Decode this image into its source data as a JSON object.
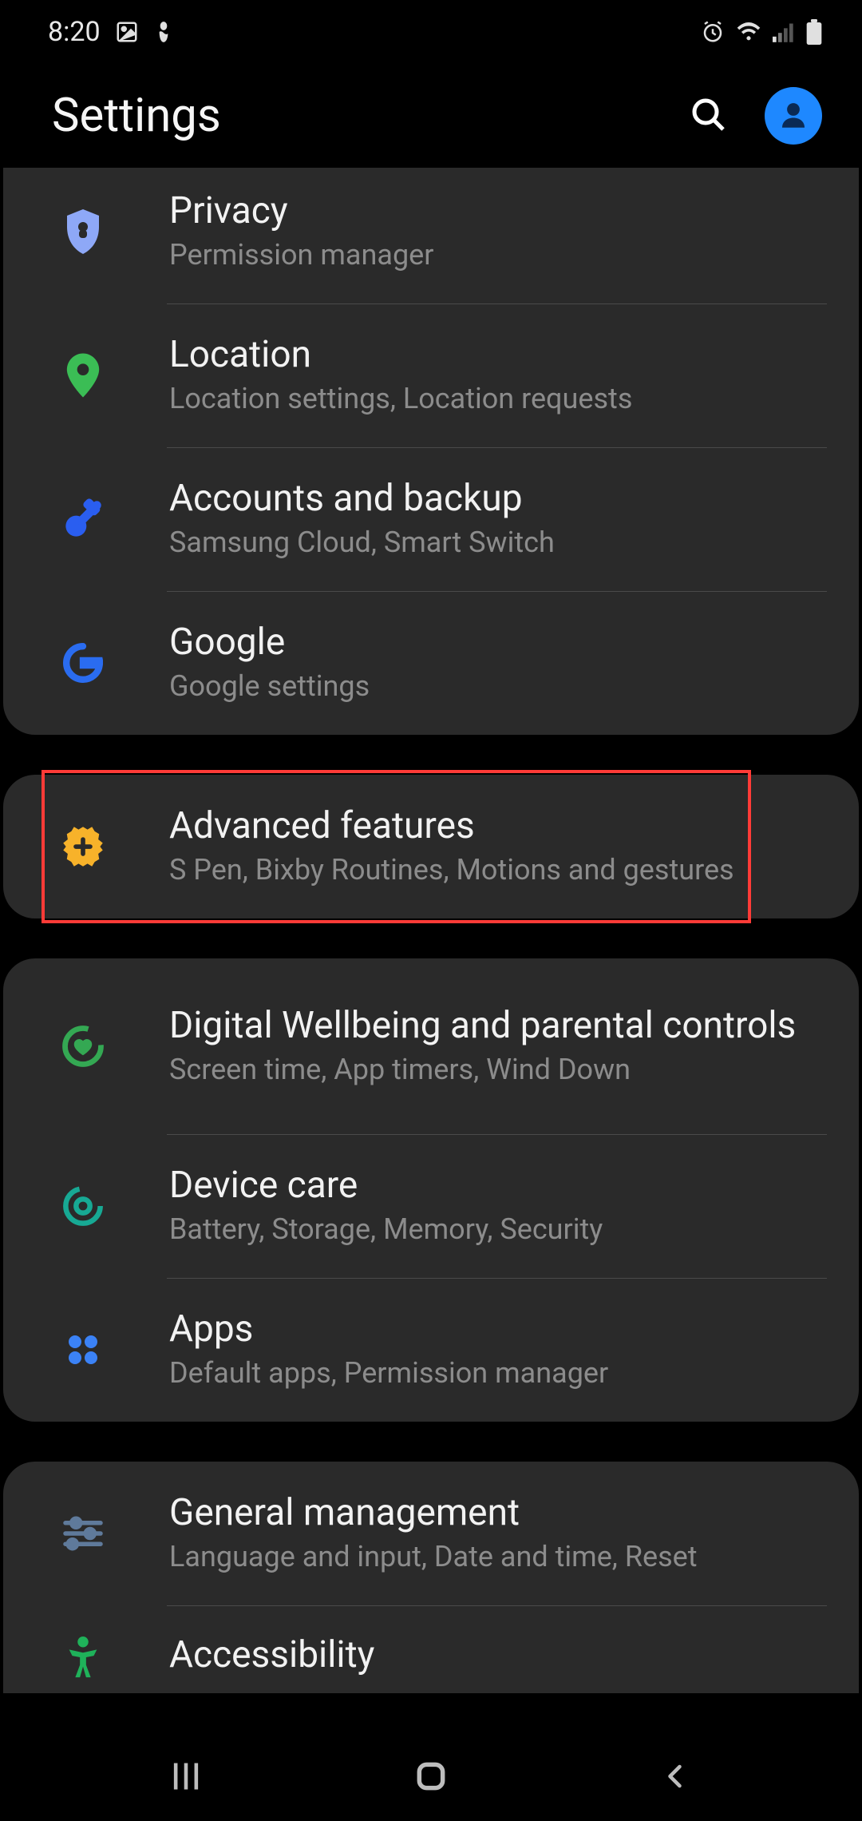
{
  "status": {
    "time": "8:20"
  },
  "header": {
    "title": "Settings"
  },
  "groups": [
    {
      "cutTop": true,
      "rows": [
        {
          "icon": "privacy",
          "title": "Privacy",
          "sub": "Permission manager"
        },
        {
          "icon": "location",
          "title": "Location",
          "sub": "Location settings, Location requests"
        },
        {
          "icon": "accounts",
          "title": "Accounts and backup",
          "sub": "Samsung Cloud, Smart Switch"
        },
        {
          "icon": "google",
          "title": "Google",
          "sub": "Google settings"
        }
      ]
    },
    {
      "highlighted": 0,
      "rows": [
        {
          "icon": "advanced",
          "title": "Advanced features",
          "sub": "S Pen, Bixby Routines, Motions and gestures"
        }
      ]
    },
    {
      "rows": [
        {
          "icon": "wellbeing",
          "title": "Digital Wellbeing and parental controls",
          "sub": "Screen time, App timers, Wind Down"
        },
        {
          "icon": "devicecare",
          "title": "Device care",
          "sub": "Battery, Storage, Memory, Security"
        },
        {
          "icon": "apps",
          "title": "Apps",
          "sub": "Default apps, Permission manager"
        }
      ]
    },
    {
      "cutBottom": true,
      "rows": [
        {
          "icon": "general",
          "title": "General management",
          "sub": "Language and input, Date and time, Reset"
        },
        {
          "icon": "accessibility",
          "title": "Accessibility",
          "sub": ""
        }
      ]
    }
  ],
  "colors": {
    "privacy": "#8ea8f7",
    "location": "#3bbd55",
    "accounts": "#2a5ef0",
    "google": "#2a6cf0",
    "advanced": "#f7b22a",
    "wellbeing": "#34a853",
    "devicecare": "#17a994",
    "apps": "#3b82f6",
    "general": "#5f7a9b",
    "accessibility": "#1fb25a"
  }
}
